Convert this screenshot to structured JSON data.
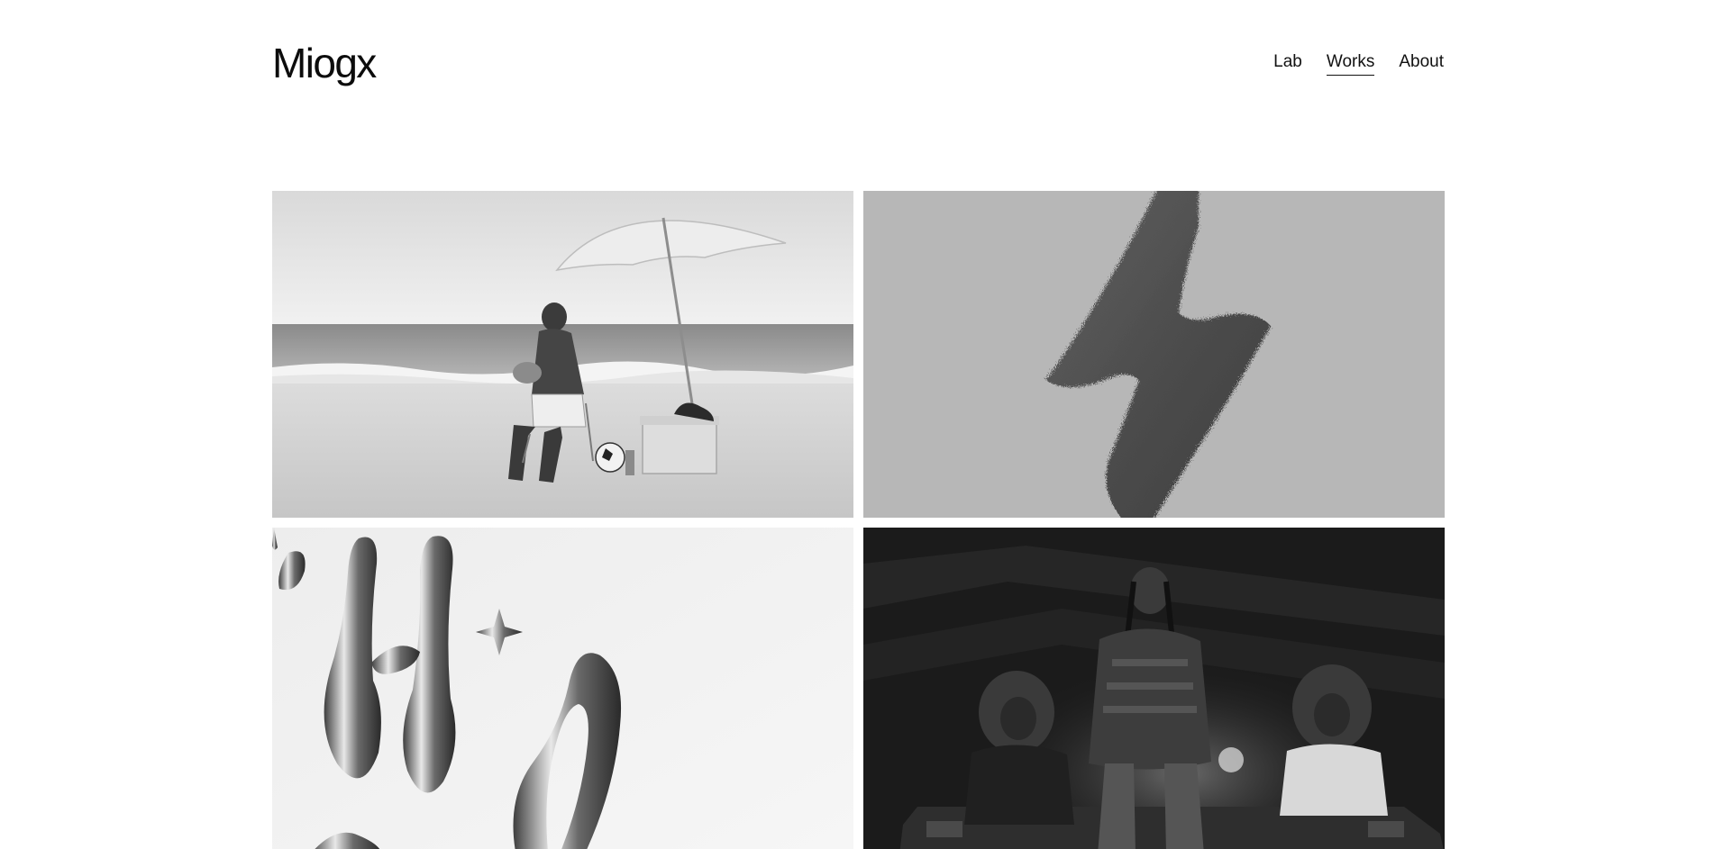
{
  "header": {
    "logo": "Miogx",
    "nav": [
      {
        "label": "Lab",
        "active": false
      },
      {
        "label": "Works",
        "active": true
      },
      {
        "label": "About",
        "active": false
      }
    ]
  },
  "works": [
    {
      "image": "beach-man-umbrella-photo"
    },
    {
      "image": "furry-lightning-bolt-render"
    },
    {
      "image": "chrome-liquid-letters-render"
    },
    {
      "image": "group-portrait-car-night-photo"
    }
  ]
}
